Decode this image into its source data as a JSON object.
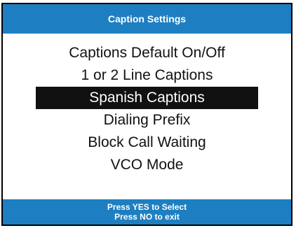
{
  "header": {
    "title": "Caption Settings"
  },
  "menu": {
    "selected_index": 2,
    "items": [
      {
        "label": "Captions Default On/Off"
      },
      {
        "label": "1 or 2 Line Captions"
      },
      {
        "label": "Spanish Captions"
      },
      {
        "label": "Dialing Prefix"
      },
      {
        "label": "Block Call Waiting"
      },
      {
        "label": "VCO Mode"
      }
    ]
  },
  "footer": {
    "line1": "Press YES to Select",
    "line2": "Press NO to exit"
  },
  "colors": {
    "bar": "#1d7fc1",
    "highlight": "#111111",
    "text": "#111111",
    "background": "#ffffff"
  }
}
